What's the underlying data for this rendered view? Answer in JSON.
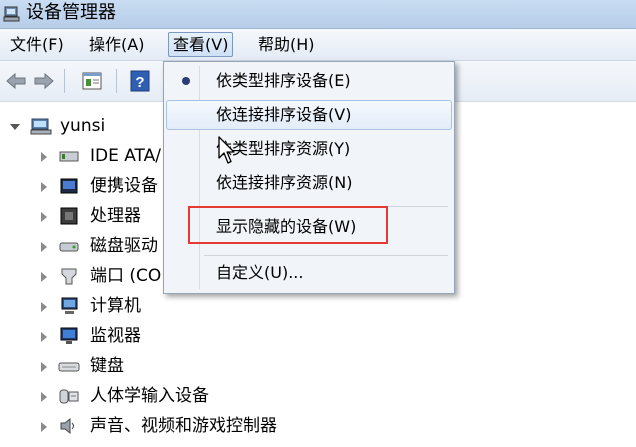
{
  "window": {
    "title": "设备管理器"
  },
  "menubar": {
    "items": [
      {
        "label": "文件(F)"
      },
      {
        "label": "操作(A)"
      },
      {
        "label": "查看(V)"
      },
      {
        "label": "帮助(H)"
      }
    ]
  },
  "tree": {
    "root": "yunsi",
    "items": [
      {
        "label": "IDE ATA/"
      },
      {
        "label": "便携设备"
      },
      {
        "label": "处理器"
      },
      {
        "label": "磁盘驱动"
      },
      {
        "label": "端口 (CO"
      },
      {
        "label": "计算机"
      },
      {
        "label": "监视器"
      },
      {
        "label": "键盘"
      },
      {
        "label": "人体学输入设备"
      },
      {
        "label": "声音、视频和游戏控制器"
      }
    ]
  },
  "view_menu": {
    "items": [
      {
        "label": "依类型排序设备(E)"
      },
      {
        "label": "依连接排序设备(V)"
      },
      {
        "label": "依类型排序资源(Y)"
      },
      {
        "label": "依连接排序资源(N)"
      },
      {
        "label": "显示隐藏的设备(W)"
      },
      {
        "label": "自定义(U)..."
      }
    ]
  }
}
